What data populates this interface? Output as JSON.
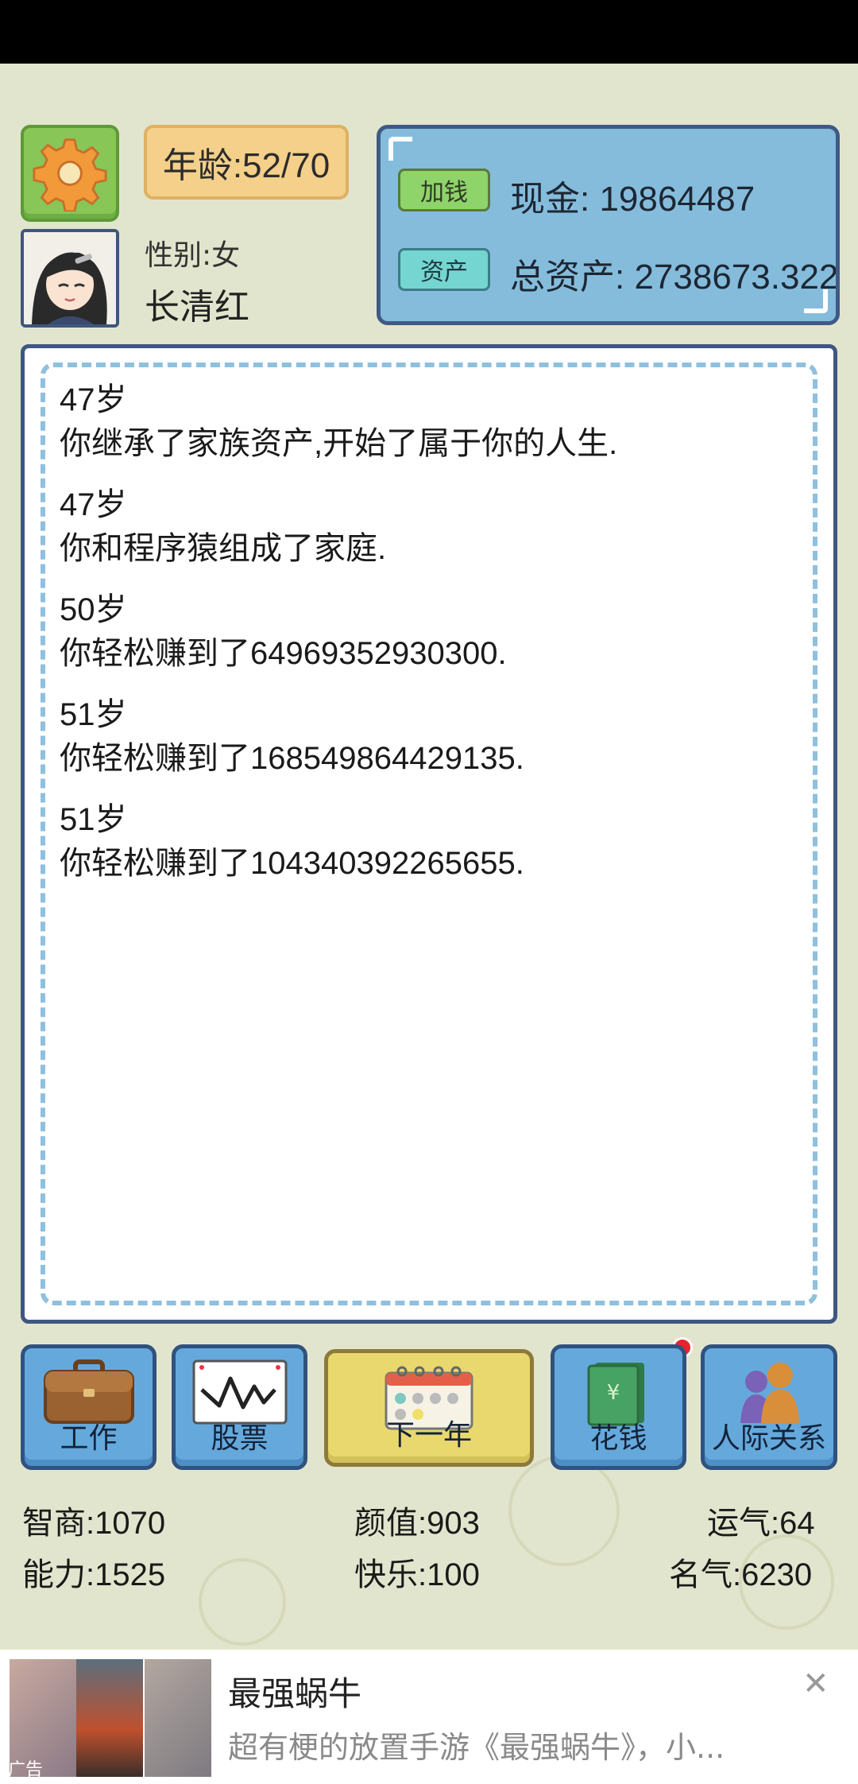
{
  "header": {
    "age_label": "年龄:52/70",
    "gender_label": "性别:女",
    "player_name": "长清红"
  },
  "money": {
    "add_button": "加钱",
    "asset_button": "资产",
    "cash_line": "现金: 19864487",
    "total_assets_line": "总资产: 2738673.3223"
  },
  "log": [
    {
      "age": "47岁",
      "text": "你继承了家族资产,开始了属于你的人生."
    },
    {
      "age": "47岁",
      "text": "你和程序猿组成了家庭."
    },
    {
      "age": "50岁",
      "text": "你轻松赚到了64969352930300."
    },
    {
      "age": "51岁",
      "text": "你轻松赚到了168549864429135."
    },
    {
      "age": "51岁",
      "text": "你轻松赚到了104340392265655."
    }
  ],
  "actions": {
    "work": "工作",
    "stock": "股票",
    "next_year": "下一年",
    "spend": "花钱",
    "social": "人际关系"
  },
  "stats": {
    "iq": "智商:1070",
    "looks": "颜值:903",
    "luck": "运气:64",
    "ability": "能力:1525",
    "happiness": "快乐:100",
    "fame": "名气:6230"
  },
  "ad": {
    "title": "最强蜗牛",
    "description": "超有梗的放置手游《最强蜗牛》，小...",
    "tag": "广告"
  },
  "colors": {
    "background": "#e2e5cd",
    "money_panel": "#85bcdc",
    "action_blue": "#65a9dc",
    "next_year_yellow": "#e9d86e",
    "notification_red": "#e8232e"
  }
}
